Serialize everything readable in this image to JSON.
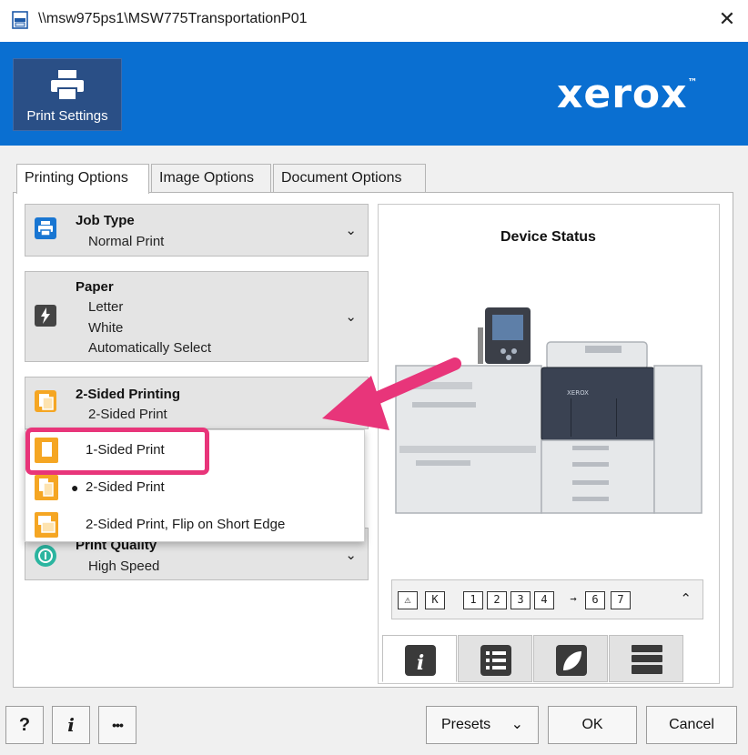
{
  "window": {
    "title": "\\\\msw975ps1\\MSW775TransportationP01",
    "close_glyph": "✕"
  },
  "header": {
    "tile_label": "Print Settings",
    "brand": "xerox",
    "brand_mark": "™",
    "brand_color": "#0a6fd1"
  },
  "tabs": [
    {
      "label": "Printing Options",
      "active": true
    },
    {
      "label": "Image Options",
      "active": false
    },
    {
      "label": "Document Options",
      "active": false
    }
  ],
  "options": {
    "job_type": {
      "title": "Job Type",
      "lines": [
        "Normal Print"
      ]
    },
    "paper": {
      "title": "Paper",
      "lines": [
        "Letter",
        "White",
        "Automatically Select"
      ]
    },
    "two_sided": {
      "title": "2-Sided Printing",
      "lines": [
        "2-Sided Print"
      ]
    },
    "print_quality": {
      "title": "Print Quality",
      "lines": [
        "High Speed"
      ]
    }
  },
  "dropdown": {
    "items": [
      {
        "label": "1-Sided Print",
        "selected": false,
        "highlighted": true
      },
      {
        "label": "2-Sided Print",
        "selected": true,
        "highlighted": false
      },
      {
        "label": "2-Sided Print, Flip on Short Edge",
        "selected": false,
        "highlighted": false
      }
    ],
    "selected_marker": "●"
  },
  "device": {
    "title": "Device Status",
    "logo_text": "XEROX"
  },
  "status_strip": {
    "glyphs": [
      "⚠",
      "K",
      "1",
      "2",
      "3",
      "4",
      "→",
      "6",
      "7"
    ]
  },
  "footer": {
    "help_label": "?",
    "info_label": "i",
    "more_label": "•••",
    "presets_label": "Presets",
    "ok_label": "OK",
    "cancel_label": "Cancel"
  },
  "colors": {
    "annotation_pink": "#e8357a",
    "icon_blue": "#1976d2",
    "icon_orange": "#f5a623",
    "icon_dark": "#444444",
    "icon_teal": "#2bb5a0"
  }
}
